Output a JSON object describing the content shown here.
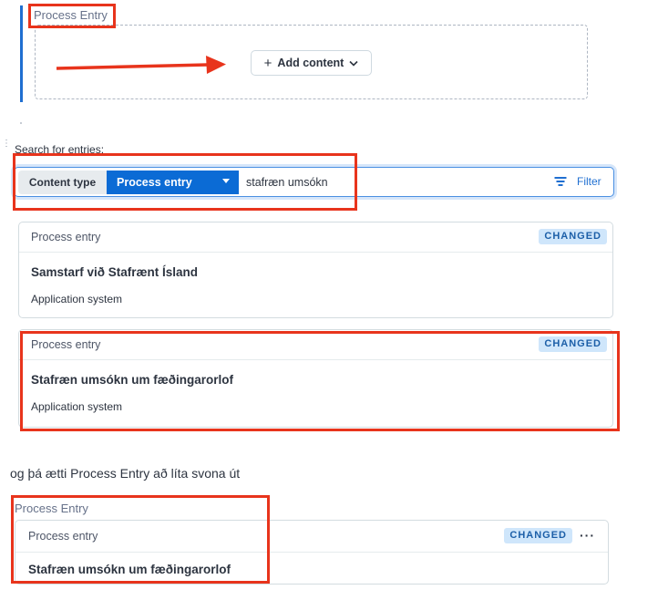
{
  "top_field": {
    "label": "Process Entry",
    "add_button_label": "Add content"
  },
  "search": {
    "label": "Search for entries:",
    "content_type_label": "Content type",
    "content_type_value": "Process entry",
    "query": "stafræn umsókn",
    "filter_label": "Filter"
  },
  "results": [
    {
      "type": "Process entry",
      "status": "CHANGED",
      "title": "Samstarf við Stafrænt Ísland",
      "subtitle": "Application system"
    },
    {
      "type": "Process entry",
      "status": "CHANGED",
      "title": "Stafræn umsókn um fæðingarorlof",
      "subtitle": "Application system"
    }
  ],
  "note": "og þá ætti Process Entry að líta svona út",
  "preview": {
    "label": "Process Entry",
    "type": "Process entry",
    "status": "CHANGED",
    "title": "Stafræn umsókn um fæðingarorlof"
  },
  "colors": {
    "annotation_red": "#e8341c",
    "primary_blue": "#0b6bd5",
    "badge_bg": "#cfe6fb"
  },
  "icons": [
    "plus-icon",
    "chevron-down-icon",
    "filter-icon",
    "more-options-icon"
  ]
}
